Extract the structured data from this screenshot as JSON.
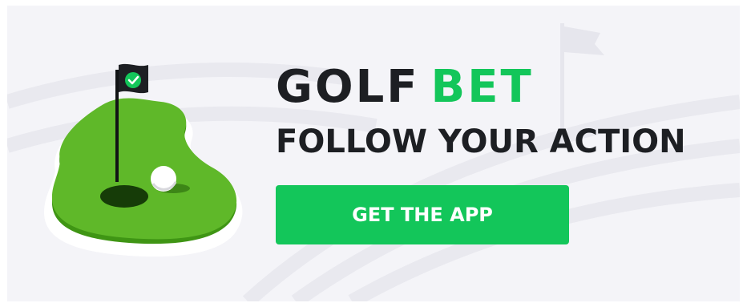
{
  "brand": {
    "name_part1": "GOLF",
    "name_part2": "BET"
  },
  "tagline": "FOLLOW YOUR ACTION",
  "cta": {
    "label": "GET THE APP"
  },
  "colors": {
    "brand_green": "#13c65a",
    "text_dark": "#1d1f23",
    "background": "#f4f4f8",
    "grass_light": "#5fb829",
    "grass_dark": "#3f9514"
  },
  "icons": {
    "flag": "golf-flag-icon",
    "check": "check-icon",
    "ball": "golf-ball-icon"
  }
}
